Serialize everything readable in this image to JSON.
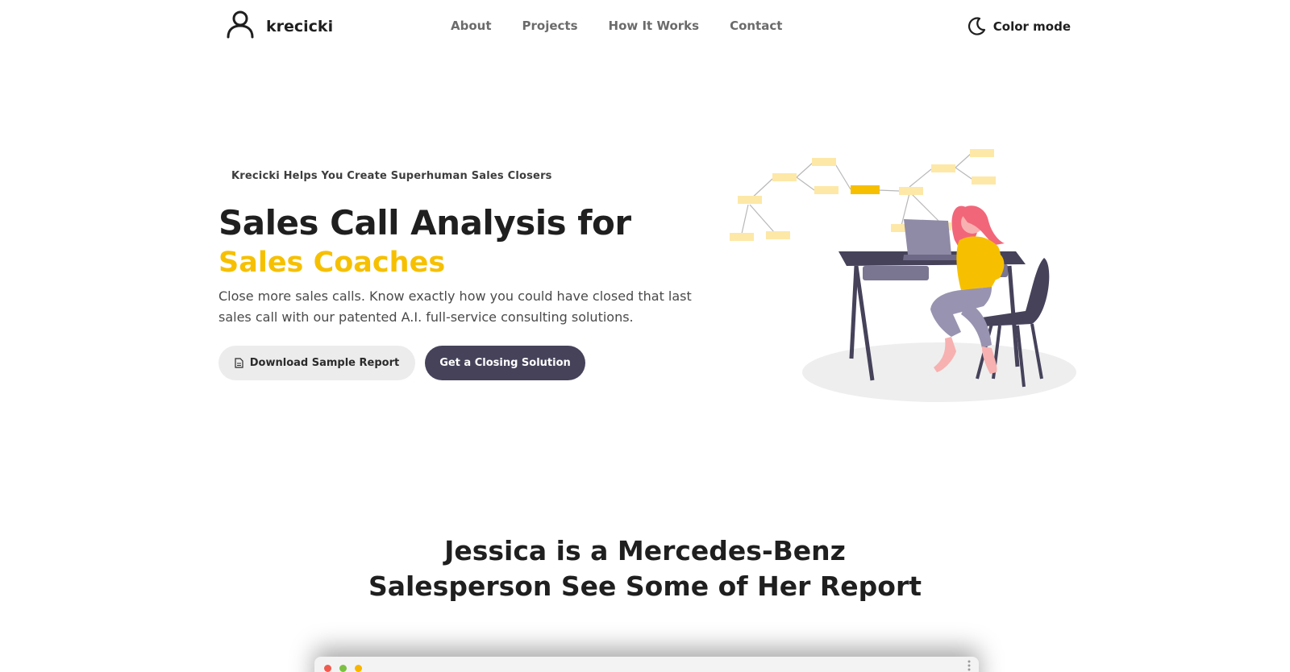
{
  "nav": {
    "brand": "krecicki",
    "links": [
      "About",
      "Projects",
      "How It Works",
      "Contact"
    ],
    "color_mode_label": "Color mode"
  },
  "hero": {
    "eyebrow": "Krecicki Helps You Create Superhuman Sales Closers",
    "headline": "Sales Call Analysis for",
    "headline_accent": "Sales Coaches",
    "subtext": "Close more sales calls. Know exactly how you could have closed that last sales call with our patented A.I. full-service consulting solutions.",
    "btn_download": "Download Sample Report",
    "btn_primary": "Get a Closing Solution"
  },
  "section": {
    "title_line1": "Jessica is a Mercedes-Benz",
    "title_line2": "Salesperson See Some of Her Report"
  },
  "colors": {
    "accent": "#f6c000",
    "primary_button": "#45425a",
    "secondary_button": "#ececec",
    "window_dot_red": "#f05a4f",
    "window_dot_green": "#7bc043",
    "window_dot_yellow": "#f7b500"
  },
  "icons": {
    "logo": "user-icon",
    "color_mode": "moon-icon",
    "download": "document-icon"
  }
}
